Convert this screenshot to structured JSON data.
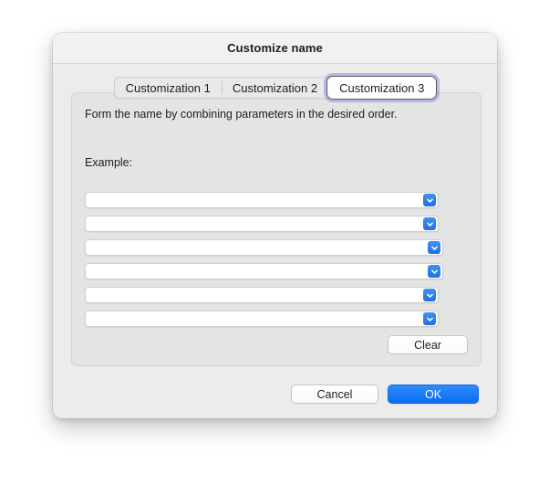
{
  "dialog": {
    "title": "Customize name",
    "tabs": [
      {
        "label": "Customization 1",
        "selected": false
      },
      {
        "label": "Customization 2",
        "selected": false
      },
      {
        "label": "Customization 3",
        "selected": true
      }
    ],
    "content": {
      "instruction": "Form the name by combining parameters in the desired order.",
      "example_label": "Example:",
      "dropdowns": [
        {
          "value": "",
          "placeholder": ""
        },
        {
          "value": "",
          "placeholder": ""
        },
        {
          "value": "",
          "placeholder": ""
        },
        {
          "value": "",
          "placeholder": ""
        },
        {
          "value": "",
          "placeholder": ""
        },
        {
          "value": "",
          "placeholder": ""
        }
      ],
      "clear_label": "Clear"
    },
    "actions": {
      "cancel_label": "Cancel",
      "ok_label": "OK"
    }
  },
  "icons": {
    "dropdown_chevron": "chevron-down-icon"
  },
  "colors": {
    "accent_blue": "#0a6ef0",
    "dropdown_arrow_blue": "#1f72e0",
    "focus_ring": "#6e82e1",
    "panel_gray": "#e4e4e4",
    "window_gray": "#ececec",
    "titlebar_gray": "#f1f1f1"
  }
}
